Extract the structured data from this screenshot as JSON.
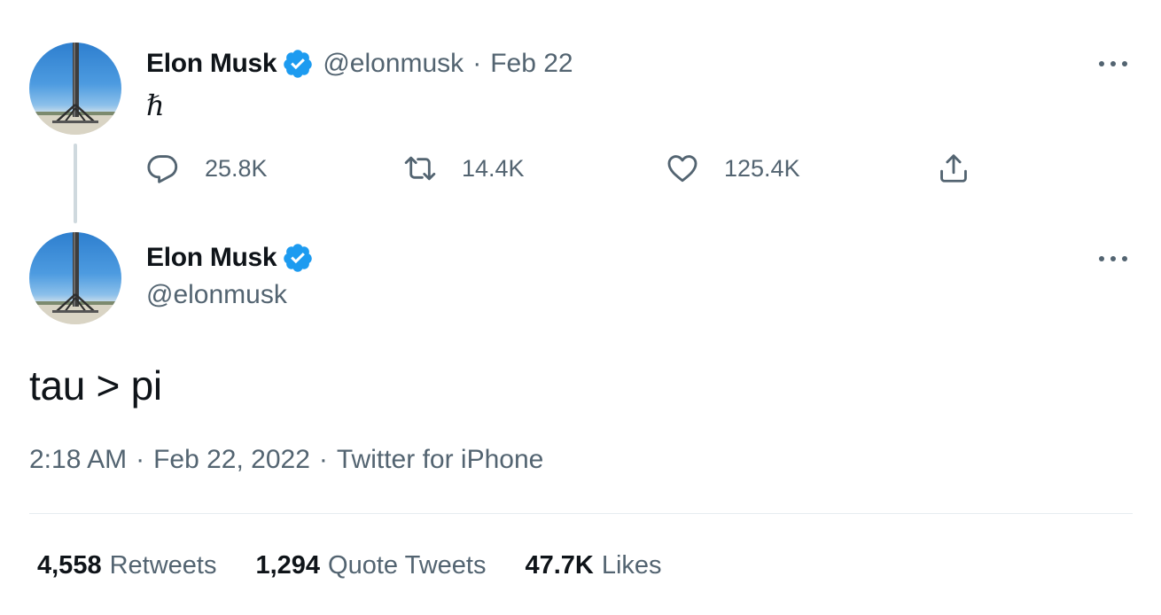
{
  "parent_tweet": {
    "author_name": "Elon Musk",
    "handle": "@elonmusk",
    "separator": "·",
    "date": "Feb 22",
    "text": "ℏ",
    "actions": {
      "reply_count": "25.8K",
      "retweet_count": "14.4K",
      "like_count": "125.4K"
    }
  },
  "main_tweet": {
    "author_name": "Elon Musk",
    "handle": "@elonmusk",
    "text": "tau > pi",
    "time": "2:18 AM",
    "date": "Feb 22, 2022",
    "source": "Twitter for iPhone",
    "separator": "·"
  },
  "stats": {
    "retweets_count": "4,558",
    "retweets_label": "Retweets",
    "quote_count": "1,294",
    "quote_label": "Quote Tweets",
    "likes_count": "47.7K",
    "likes_label": "Likes"
  },
  "icons": {
    "verified": "verified-badge-icon",
    "reply": "reply-icon",
    "retweet": "retweet-icon",
    "like": "heart-icon",
    "share": "share-icon",
    "more": "more-options-icon"
  },
  "colors": {
    "text_primary": "#0f1419",
    "text_secondary": "#536471",
    "verified_blue": "#1d9bf0",
    "thread_line": "#cfd9de",
    "divider": "#e6ecf0"
  }
}
